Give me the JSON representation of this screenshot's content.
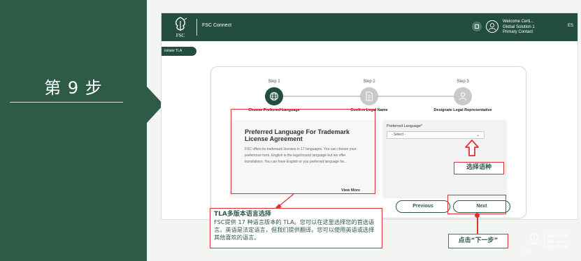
{
  "slide": {
    "step_label": "第 9 步"
  },
  "app": {
    "name": "FSC Connect",
    "logo_text": "FSC",
    "welcome_name": "Welcome Certi...",
    "welcome_org": "Global Solution 1",
    "welcome_role": "Primary Contact",
    "language_code": "ES",
    "initiate_tab": "Initiate TLA"
  },
  "wizard": {
    "steps": [
      {
        "title": "Step 1",
        "caption": "Choose Preferred Language",
        "icon": "globe-icon",
        "state": "active"
      },
      {
        "title": "Step 2",
        "caption": "Confirm Legal Name",
        "icon": "document-icon",
        "state": "inactive"
      },
      {
        "title": "Step 3",
        "caption": "Designate Legal Representative",
        "icon": "person-icon",
        "state": "inactive"
      }
    ],
    "info": {
      "title": "Preferred Language For Trademark License Agreement",
      "body": "FSC offers its trademark licenses in 17 languages. You can choose your preference here. English is the legal bound language but we offer translations. You can have English or you preferred language he...",
      "view_more": "View More"
    },
    "language_field": {
      "label": "Preferred Language*",
      "selected": "- Select -"
    },
    "previous_label": "Previous",
    "next_label": "Next"
  },
  "annotations": {
    "tla_title": "TLA多版本语言选择",
    "tla_body": "FSC提供 17 种语言版本的 TLA。您可以在这里选择您的首选语言。英语是法定语言，但我们提供翻译。您可以使用英语或选择其他喜欢的语言。",
    "select_language": "选择语种",
    "click_next": "点击“下一步”",
    "highlight_color": "#e03131"
  },
  "brand": {
    "forests_line1": "FORESTS",
    "forests_line2": "FOR ALL",
    "forests_line3": "FOREVER",
    "fsc": "FSC",
    "primary_color": "#2e5a48"
  }
}
